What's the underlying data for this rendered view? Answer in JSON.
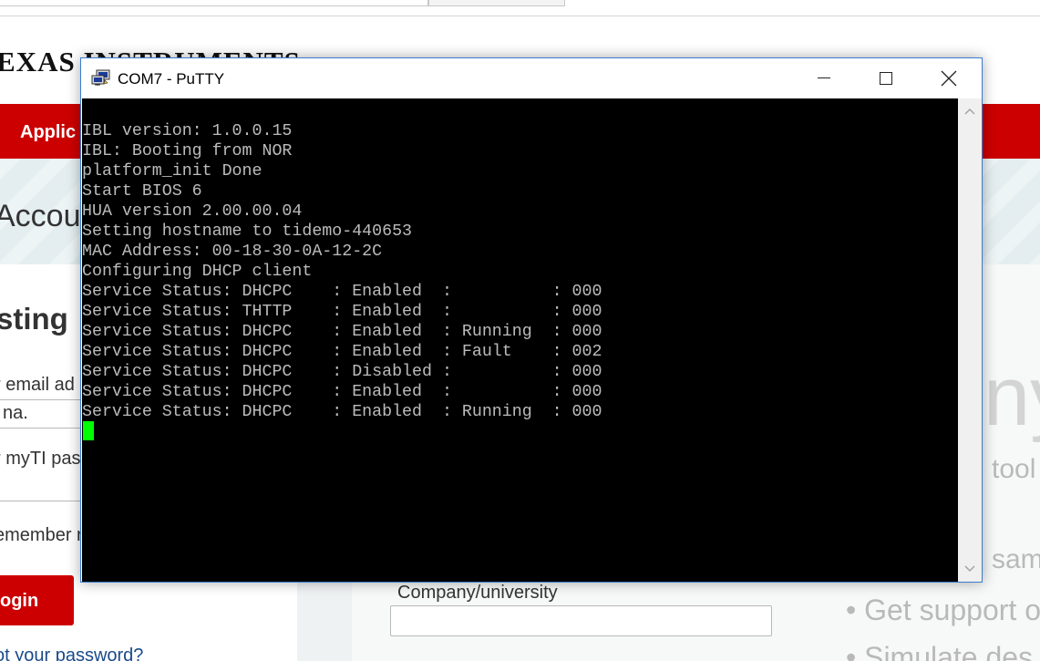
{
  "browser_page": {
    "logo_text_1": "EXAS",
    "logo_text_2": "INSTRUMENTS",
    "nav_item": "Applic",
    "banner_title": "Accour",
    "login_heading": "sting",
    "email_label": "r email ad",
    "email_value": "na.",
    "password_label": "r myTI pas",
    "remember_label": "emember r",
    "login_button": "ogin",
    "forgot_link": "ot your password?",
    "right_big_text": "ny",
    "right_tool_text": "tool",
    "right_sam_text": "sam",
    "company_label": "Company/university",
    "bullet_1": "• Get support o",
    "bullet_2": "• Simulate des"
  },
  "putty": {
    "title": "COM7 - PuTTY",
    "icons": {
      "app": "putty-app-icon",
      "minimize": "minimize-icon",
      "maximize": "maximize-icon",
      "close": "close-icon",
      "scroll_up": "chevron-up-icon",
      "scroll_down": "chevron-down-icon"
    },
    "terminal_lines": [
      "IBL version: 1.0.0.15",
      "IBL: Booting from NOR",
      "platform_init Done",
      "Start BIOS 6",
      "HUA version 2.00.00.04",
      "Setting hostname to tidemo-440653",
      "MAC Address: 00-18-30-0A-12-2C",
      "Configuring DHCP client",
      "Service Status: DHCPC    : Enabled  :          : 000",
      "Service Status: THTTP    : Enabled  :          : 000",
      "Service Status: DHCPC    : Enabled  : Running  : 000",
      "Service Status: DHCPC    : Enabled  : Fault    : 002",
      "Service Status: DHCPC    : Disabled :          : 000",
      "Service Status: DHCPC    : Enabled  :          : 000",
      "Service Status: DHCPC    : Enabled  : Running  : 000"
    ],
    "colors": {
      "terminal_bg": "#000000",
      "terminal_fg": "#bbbbbb",
      "cursor": "#00ff00",
      "window_border": "#3c7dd0"
    }
  }
}
